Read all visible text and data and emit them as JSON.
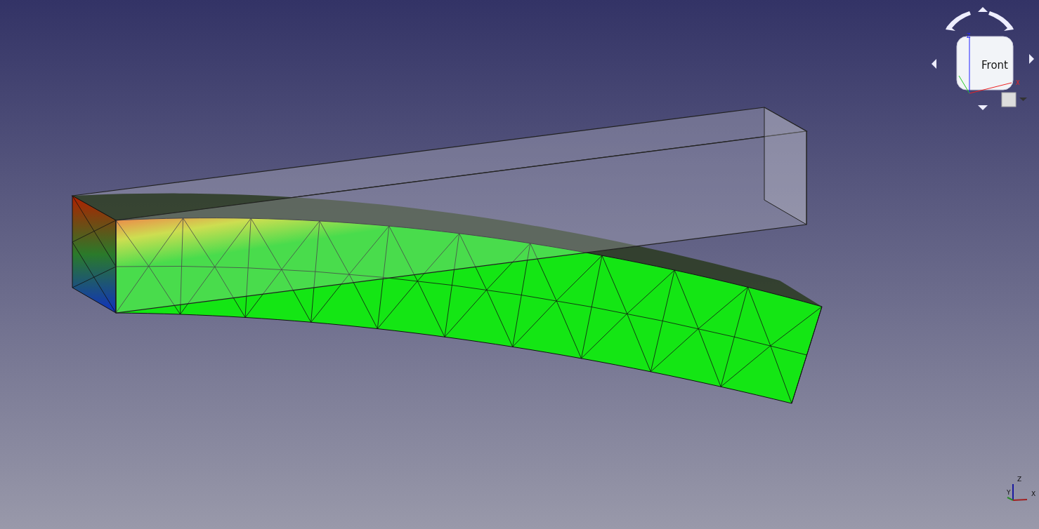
{
  "view": {
    "nav_cube": {
      "face_label": "Front",
      "axes": [
        "Z",
        "X"
      ]
    },
    "triad": {
      "axes": [
        "Z",
        "Y",
        "X"
      ]
    }
  }
}
